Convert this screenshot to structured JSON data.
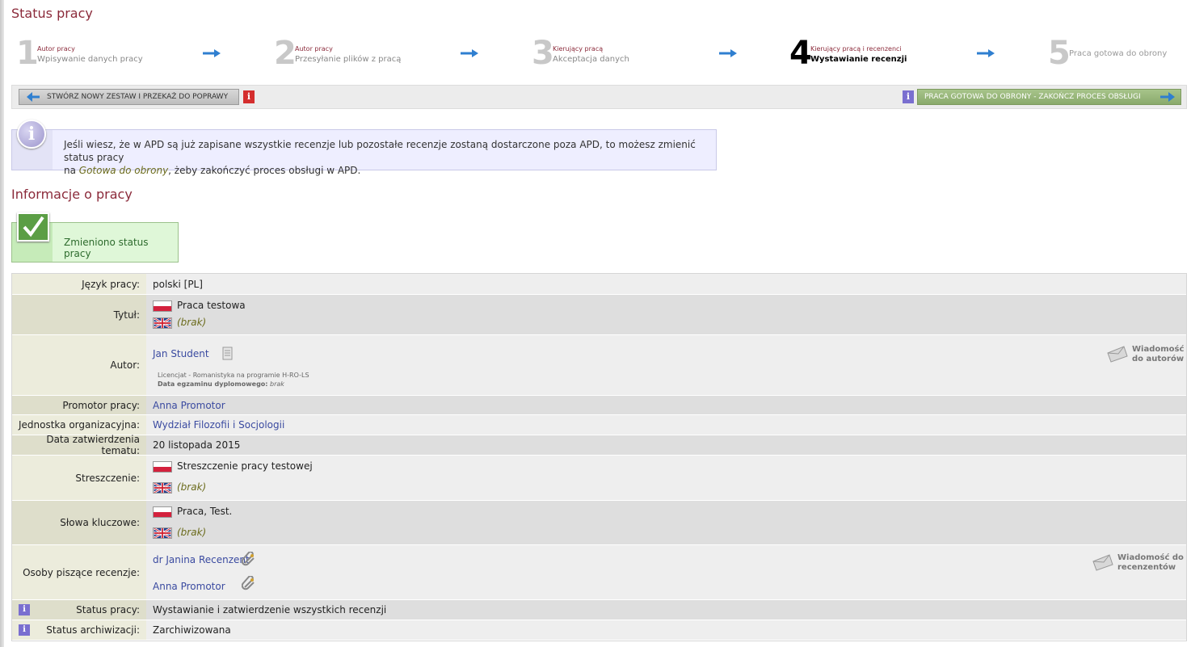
{
  "page": {
    "title": "Status pracy",
    "section_title": "Informacje o pracy"
  },
  "steps": [
    {
      "num": "1",
      "small": "Autor pracy",
      "big": "Wpisywanie danych pracy"
    },
    {
      "num": "2",
      "small": "Autor pracy",
      "big": "Przesyłanie plików z pracą"
    },
    {
      "num": "3",
      "small": "Kierujący pracą",
      "big": "Akceptacja danych"
    },
    {
      "num": "4",
      "small": "Kierujący pracą i recenzenci",
      "big": "Wystawianie recenzji"
    },
    {
      "num": "5",
      "label": "Praca gotowa do obrony"
    }
  ],
  "actions": {
    "left_button": "STWÓRZ NOWY ZESTAW I PRZEKAŻ DO POPRAWY",
    "right_button": "PRACA GOTOWA DO OBRONY - ZAKOŃCZ PROCES OBSŁUGI",
    "info_icon": "i"
  },
  "info": {
    "line1": "Jeśli wiesz, że w APD są już zapisane wszystkie recenzje lub pozostałe recenzje zostaną dostarczone poza APD, to możesz zmienić status pracy",
    "line2_prefix": "na ",
    "line2_em": "Gotowa do obrony",
    "line2_suffix": ", żeby zakończyć proces obsługi w APD."
  },
  "success": {
    "text": "Zmieniono status pracy"
  },
  "details": {
    "jezyk_label": "Język pracy:",
    "jezyk_value": "polski [PL]",
    "tytul_label": "Tytuł:",
    "tytul_pl": "Praca testowa",
    "tytul_en": "(brak)",
    "autor_label": "Autor:",
    "autor_name": "Jan Student",
    "autor_program": "Licencjat - Romanistyka na programie H-RO-LS",
    "autor_exam_label": "Data egzaminu dyplomowego:",
    "autor_exam_value": "brak",
    "autor_msg": [
      "Wiadomość",
      "do autorów"
    ],
    "promotor_label": "Promotor pracy:",
    "promotor_value": "Anna Promotor",
    "jednostka_label": "Jednostka organizacyjna:",
    "jednostka_value": "Wydział Filozofii i Socjologii",
    "data_label": "Data zatwierdzenia tematu:",
    "data_value": "20 listopada 2015",
    "streszczenie_label": "Streszczenie:",
    "streszczenie_pl": "Streszczenie pracy testowej",
    "streszczenie_en": "(brak)",
    "slowa_label": "Słowa kluczowe:",
    "slowa_pl": "Praca, Test.",
    "slowa_en": "(brak)",
    "recenzenci_label": "Osoby piszące recenzje:",
    "recenzent1": "dr Janina Recenzent",
    "recenzent2": "Anna Promotor",
    "recenzenci_msg": [
      "Wiadomość do",
      "recenzentów"
    ],
    "status_label": "Status pracy:",
    "status_value": "Wystawianie i zatwierdzenie wszystkich recenzji",
    "archiwizacja_label": "Status archiwizacji:",
    "archiwizacja_value": "Zarchiwizowana"
  },
  "colors": {
    "heading": "#8b2a3a",
    "link": "#3a4aa0",
    "accent_green": "#8aaa6c",
    "info_purple": "#7a6fd0",
    "info_red": "#d42e2e"
  }
}
